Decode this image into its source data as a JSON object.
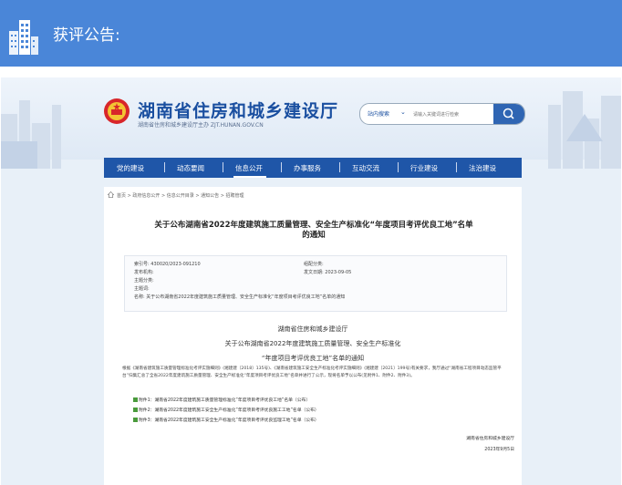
{
  "banner": {
    "title": "获评公告:",
    "icon": "building-icon",
    "color": "#4a86d8"
  },
  "site": {
    "name": "湖南省住房和城乡建设厅",
    "subtitle": "湖南省住房和城乡建设厅主办  ZJT.HUNAN.GOV.CN",
    "emblem": "national-emblem-icon",
    "search": {
      "scope": "站内搜索",
      "placeholder": "请输入关键词进行检索",
      "icon": "search-icon"
    },
    "nav": [
      {
        "label": "党的建设"
      },
      {
        "label": "动态要闻"
      },
      {
        "label": "信息公开"
      },
      {
        "label": "办事服务"
      },
      {
        "label": "互动交流"
      },
      {
        "label": "行业建设"
      },
      {
        "label": "法治建设"
      }
    ],
    "nav_active_index": 2,
    "nav_color": "#1f56a8"
  },
  "article": {
    "breadcrumb": "首页 > 政府信息公开 > 信息公开目录 > 通知公告 > 招聘管理",
    "title_line1": "关于公布湖南省2022年度建筑施工质量管理、安全生产标准化“年度项目考评优良工地”名单",
    "title_line2": "的通知",
    "meta": {
      "index_label": "索引号:",
      "index_value": "430020/2023-091210",
      "category_label": "组配分类:",
      "category_value": "",
      "publisher_label": "发布机构:",
      "publisher_value": "",
      "date_label": "发文日期:",
      "date_value": "2023-09-05",
      "theme_label": "主题分类:",
      "theme_value": "",
      "subject_label": "主题词:",
      "subject_value": "",
      "name_label": "名称:",
      "name_value": "关于公布湖南省2022年度建筑施工质量管理、安全生产标准化“年度项目考评优良工地”名单的通知"
    },
    "body_h1": "湖南省住房和城乡建设厅",
    "body_h2": "关于公布湖南省2022年度建筑施工质量管理、安全生产标准化",
    "body_h3": "“年度项目考评优良工地”名单的通知",
    "paragraph": "根据《湖南省建筑施工质量管理标准化考评实施细则》(湘建建〔2018〕135号)、《湖南省建筑施工安全生产标准化考评实施细则》(湘建建〔2021〕199号)有关要求，我厅通过“湖南省工程项目动态监管平台”归集汇总了全省2022年度建筑施工质量管理、安全生产标准化“年度项目考评优良工地”名单并进行了公示，现将名单予以公布(见附件1、附件2、附件3)。",
    "attachments": [
      "附件1：湖南省2022年度建筑施工质量管理标准化“年度项目考评优良工地”名单（公布）",
      "附件2：湖南省2022年度建筑施工安全生产标准化“年度项目考评优良施工工地”名单（公布）",
      "附件3：湖南省2022年度建筑施工安全生产标准化“年度项目考评优良监理工地”名单（公布）"
    ],
    "sign_org": "湖南省住房和城乡建设厅",
    "sign_date": "2023年9月5日"
  }
}
